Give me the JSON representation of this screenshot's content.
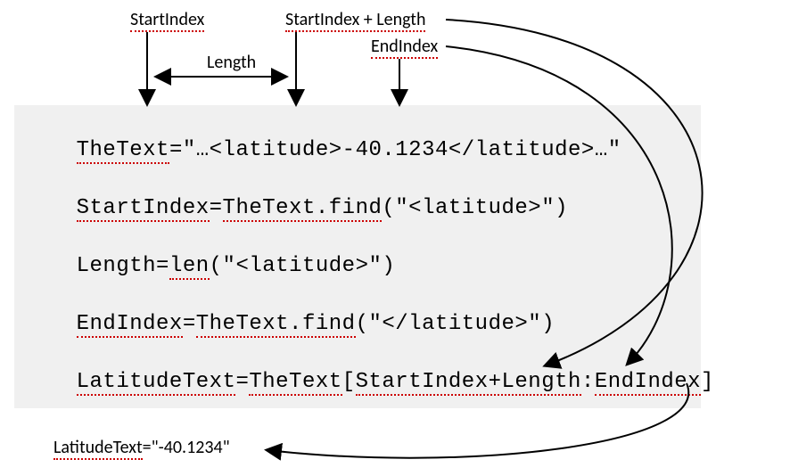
{
  "labels": {
    "startIndex": "StartIndex",
    "startPlusLength": "StartIndex + Length",
    "length": "Length",
    "endIndex": "EndIndex",
    "latitudeTextLeft": "LatitudeText",
    "latitudeTextRight": "=\"-40.1234\""
  },
  "code": {
    "line1_pre": "TheText",
    "line1_mid": "=\"…<latitude>-40.1234</latitude>…\"",
    "line2_a": "StartIndex",
    "line2_b": "=",
    "line2_c": "TheText.find",
    "line2_d": "(\"<latitude>\")",
    "line3_a": "Length=",
    "line3_b": "len",
    "line3_c": "(\"<latitude>\")",
    "line4_a": "EndIndex",
    "line4_b": "=",
    "line4_c": "TheText.find",
    "line4_d": "(\"</latitude>\")",
    "line5_a": "LatitudeText",
    "line5_b": "=",
    "line5_c": "TheText",
    "line5_d": "[",
    "line5_e": "StartIndex+Length",
    "line5_f": ":",
    "line5_g": "EndIndex",
    "line5_h": "]"
  }
}
